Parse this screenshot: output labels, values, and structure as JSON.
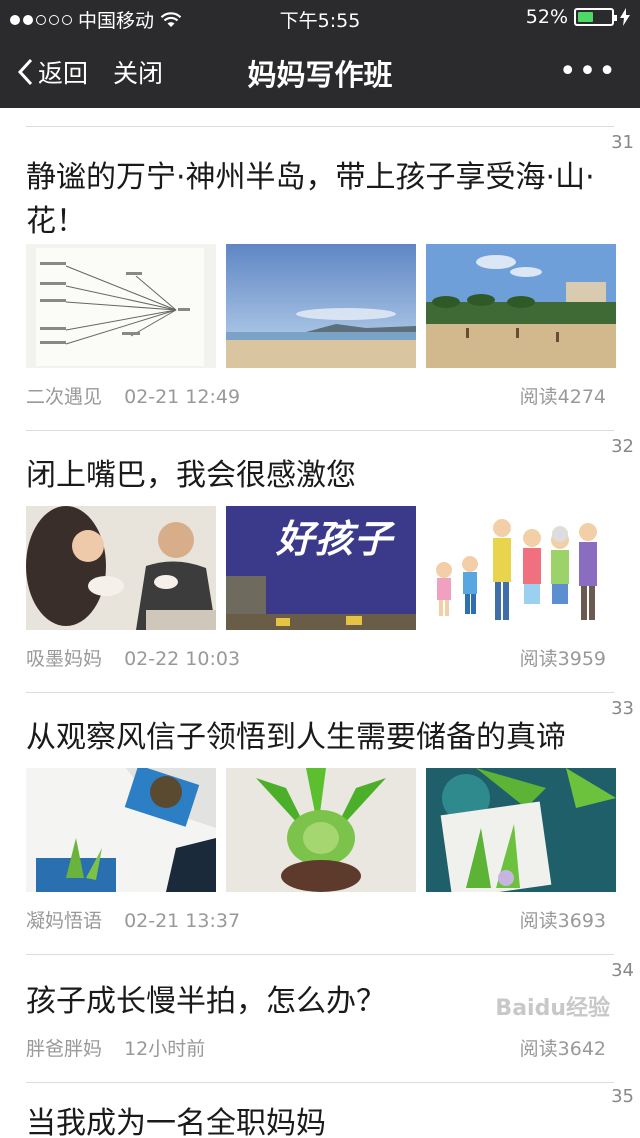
{
  "status_bar": {
    "carrier": "中国移动",
    "time": "下午5:55",
    "battery": "52%",
    "battery_level": 0.52
  },
  "nav": {
    "back_label": "返回",
    "close_label": "关闭",
    "title": "妈妈写作班",
    "more_label": "•••"
  },
  "articles": [
    {
      "num": "31",
      "title": "静谧的万宁·神州半岛，带上孩子享受海·山·花！",
      "source": "二次遇见",
      "time": "02-21 12:49",
      "reads": "阅读4274"
    },
    {
      "num": "32",
      "title": "闭上嘴巴，我会很感激您",
      "source": "吸墨妈妈",
      "time": "02-22 10:03",
      "reads": "阅读3959",
      "badge": "好孩子"
    },
    {
      "num": "33",
      "title": "从观察风信子领悟到人生需要储备的真谛",
      "source": "凝妈悟语",
      "time": "02-21 13:37",
      "reads": "阅读3693"
    },
    {
      "num": "34",
      "title": "孩子成长慢半拍，怎么办？",
      "source": "胖爸胖妈",
      "time": "12小时前",
      "reads": "阅读3642"
    },
    {
      "num": "35",
      "title": "当我成为一名全职妈妈"
    }
  ],
  "watermark": "Baidu经验"
}
